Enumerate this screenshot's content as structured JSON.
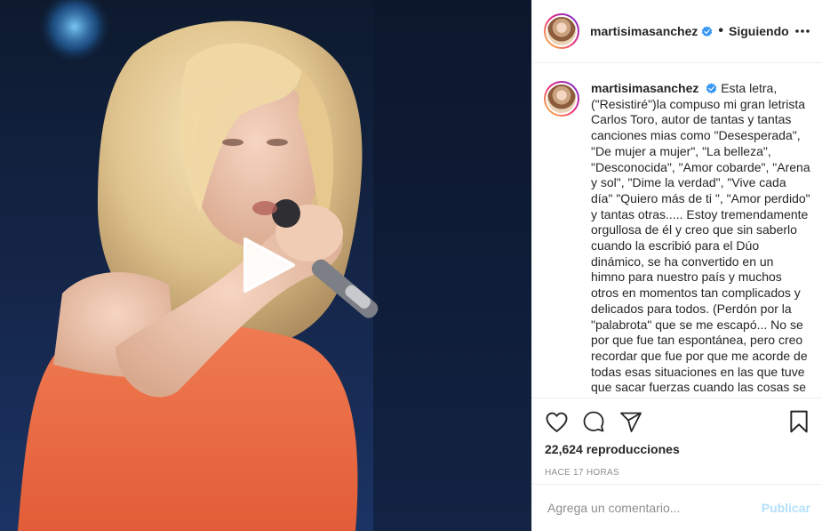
{
  "post": {
    "username": "martisimasanchez",
    "follow_status": "Siguiendo",
    "separator": "•",
    "caption": "Esta letra, (\"Resistiré\")la compuso mi gran letrista Carlos Toro, autor de tantas y tantas canciones mias como \"Desesperada\", \"De mujer a mujer\", \"La belleza\", \"Desconocida\", \"Amor cobarde\", \"Arena y sol\", \"Dime la verdad\", \"Vive cada día\" \"Quiero más de ti \", \"Amor perdido\" y tantas otras..... Estoy tremendamente orgullosa de él y creo que sin saberlo cuando la escribió para el Dúo dinámico, se ha convertido en un himno para nuestro país y muchos otros en momentos tan complicados y delicados para todos. (Perdón por la \"palabrota\" que se me escapó... No se por que fue tan espontánea, pero creo recordar que fue por que me acorde de todas esas situaciones en las que tuve que sacar fuerzas cuando las cosas se",
    "views": "22,624 reproducciones",
    "timestamp": "HACE 17 HORAS"
  },
  "comment": {
    "placeholder": "Agrega un comentario...",
    "publish_label": "Publicar"
  },
  "icons": {
    "header": [
      "verified-badge-icon",
      "more-options-icon"
    ],
    "actions": [
      "heart-icon",
      "comment-icon",
      "share-icon",
      "bookmark-icon"
    ],
    "media": [
      "play-icon"
    ]
  },
  "colors": {
    "verified": "#3897f0",
    "publish_disabled": "#b2dffc",
    "muted_text": "#8e8e8e",
    "border": "#efefef"
  }
}
